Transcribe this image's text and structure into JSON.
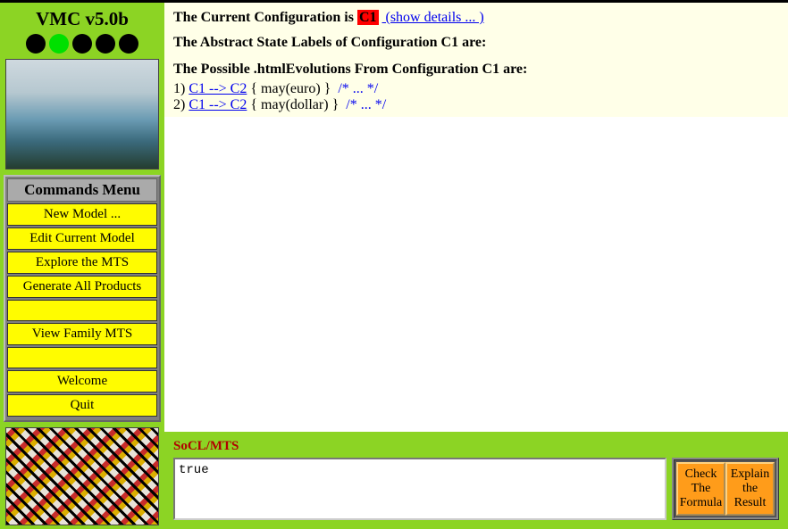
{
  "sidebar": {
    "title": "VMC v5.0b",
    "menu_header": "Commands Menu",
    "items": {
      "new_model": "New Model ...",
      "edit_model": "Edit Current Model",
      "explore_mts": "Explore the MTS",
      "gen_products": "Generate All Products",
      "view_family": "View Family MTS",
      "welcome": "Welcome",
      "quit": "Quit"
    }
  },
  "content": {
    "line1_prefix": "The Current Configuration is ",
    "c1_label": "C1",
    "show_details": " (show details ... )",
    "line2": "The Abstract State Labels of Configuration C1 are:",
    "line3": "The Possible .htmlEvolutions From Configuration C1 are:",
    "evolutions": [
      {
        "num": "1) ",
        "link": "C1 --> C2",
        "rest": " { may(euro) } ",
        "comment": " /* ... */"
      },
      {
        "num": "2) ",
        "link": "C1 --> C2",
        "rest": " { may(dollar) } ",
        "comment": " /* ... */"
      }
    ]
  },
  "footer": {
    "label": "SoCL/MTS",
    "formula_value": "true",
    "check_btn": "Check The Formula",
    "explain_btn": "Explain the Result"
  }
}
